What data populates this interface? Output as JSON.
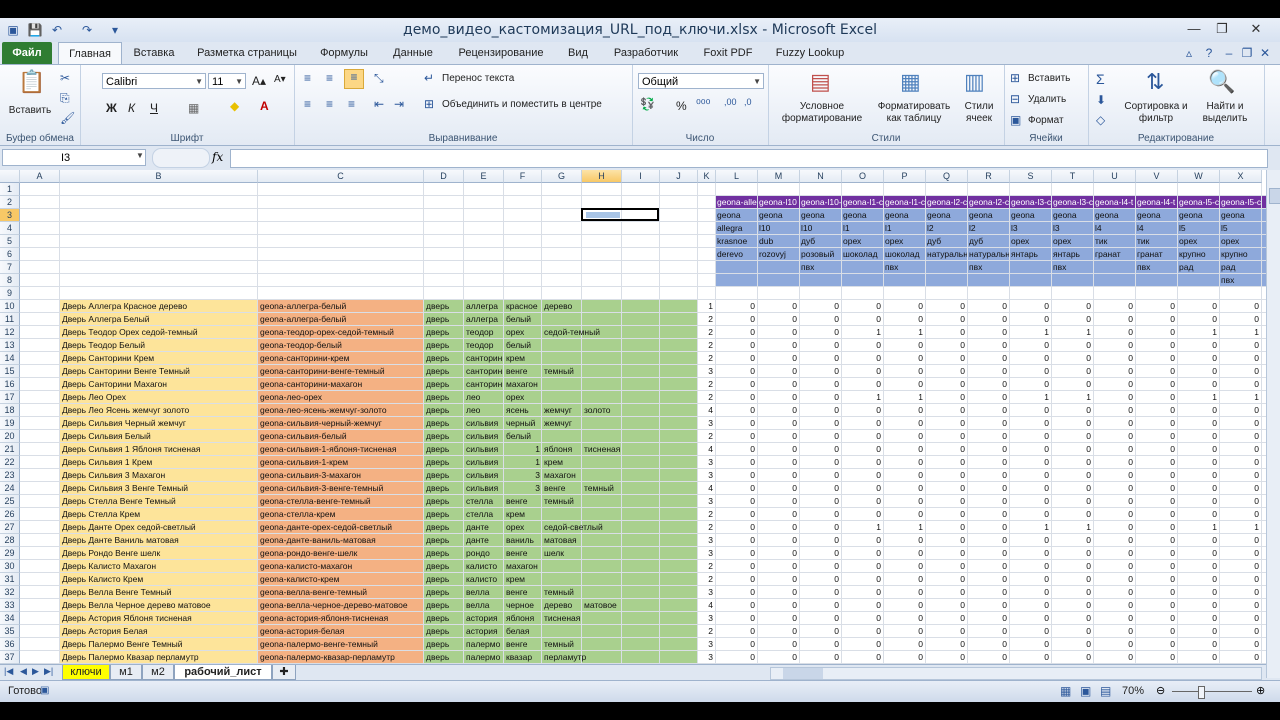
{
  "window": {
    "title": "демо_видео_кастомизация_URL_под_ключи.xlsx - Microsoft Excel"
  },
  "tabs": [
    "Файл",
    "Главная",
    "Вставка",
    "Разметка страницы",
    "Формулы",
    "Данные",
    "Рецензирование",
    "Вид",
    "Разработчик",
    "Foxit PDF",
    "Fuzzy Lookup"
  ],
  "ribbon": {
    "paste": "Вставить",
    "clipboard": "Буфер обмена",
    "font_name": "Calibri",
    "font_size": "11",
    "bold": "Ж",
    "italic": "К",
    "underline": "Ч",
    "font_group": "Шрифт",
    "wrap": "Перенос текста",
    "merge": "Объединить и поместить в центре",
    "align_group": "Выравнивание",
    "number_format": "Общий",
    "percent": "%",
    "number_group": "Число",
    "cond_format": "Условное форматирование",
    "format_table": "Форматировать как таблицу",
    "cell_styles": "Стили ячеек",
    "styles_group": "Стили",
    "insert": "Вставить",
    "delete": "Удалить",
    "format": "Формат",
    "cells_group": "Ячейки",
    "sort": "Сортировка и фильтр",
    "find": "Найти и выделить",
    "edit_group": "Редактирование"
  },
  "formula_bar": {
    "name_box": "I3",
    "fx": "fx",
    "content": ""
  },
  "columns": [
    "A",
    "B",
    "C",
    "D",
    "E",
    "F",
    "G",
    "H",
    "I",
    "J",
    "K",
    "L",
    "M",
    "N",
    "O",
    "P",
    "Q",
    "R",
    "S",
    "T",
    "U",
    "V",
    "W",
    "X"
  ],
  "selected_column": "H",
  "selected_row": "3",
  "header_row2": [
    "geona-alle",
    "geona-l10",
    "geona-l10-",
    "geona-l1-c",
    "geona-l1-c",
    "geona-l2-c",
    "geona-l2-c",
    "geona-l3-c",
    "geona-l3-c",
    "geona-l4-t",
    "geona-l4-t",
    "geona-l5-c",
    "geona-l5-c"
  ],
  "header_block": [
    [
      "geona",
      "allegra",
      "krasnoe",
      "derevo"
    ],
    [
      "geona",
      "l10",
      "dub",
      "rozovyj"
    ],
    [
      "geona",
      "l10",
      "дуб",
      "розовый",
      "пвх"
    ],
    [
      "geona",
      "l1",
      "орех",
      "шоколад"
    ],
    [
      "geona",
      "l1",
      "орех",
      "шоколад",
      "пвх"
    ],
    [
      "geona",
      "l2",
      "дуб",
      "натуральн"
    ],
    [
      "geona",
      "l2",
      "дуб",
      "натуральн",
      "пвх"
    ],
    [
      "geona",
      "l3",
      "орех",
      "янтарь"
    ],
    [
      "geona",
      "l3",
      "орех",
      "янтарь",
      "пвх"
    ],
    [
      "geona",
      "l4",
      "тик",
      "гранат"
    ],
    [
      "geona",
      "l4",
      "тик",
      "гранат",
      "пвх"
    ],
    [
      "geona",
      "l5",
      "орех",
      "крупно",
      "рад"
    ],
    [
      "geona",
      "l5",
      "орех",
      "крупно",
      "рад",
      "пвх"
    ]
  ],
  "rows": [
    {
      "n": "10",
      "b": "Дверь Аллегра Красное дерево",
      "c": "geona-аллегра-белый",
      "w": [
        "дверь",
        "аллегра",
        "красное",
        "дерево"
      ],
      "k": "1",
      "v": [
        "0",
        "0",
        "0",
        "0",
        "0",
        "0",
        "0",
        "0",
        "0",
        "0",
        "0",
        "0",
        "0"
      ]
    },
    {
      "n": "11",
      "b": "Дверь Аллегра Белый",
      "c": "geona-аллегра-белый",
      "w": [
        "дверь",
        "аллегра",
        "белый"
      ],
      "k": "2",
      "v": [
        "0",
        "0",
        "0",
        "0",
        "0",
        "0",
        "0",
        "0",
        "0",
        "0",
        "0",
        "0",
        "0"
      ]
    },
    {
      "n": "12",
      "b": "Дверь Теодор Орех седой-темный",
      "c": "geona-теодор-орех-седой-темный",
      "w": [
        "дверь",
        "теодор",
        "орех",
        "седой-темный"
      ],
      "k": "2",
      "v": [
        "0",
        "0",
        "0",
        "1",
        "1",
        "0",
        "0",
        "1",
        "1",
        "0",
        "0",
        "1",
        "1"
      ]
    },
    {
      "n": "13",
      "b": "Дверь Теодор Белый",
      "c": "geona-теодор-белый",
      "w": [
        "дверь",
        "теодор",
        "белый"
      ],
      "k": "2",
      "v": [
        "0",
        "0",
        "0",
        "0",
        "0",
        "0",
        "0",
        "0",
        "0",
        "0",
        "0",
        "0",
        "0"
      ]
    },
    {
      "n": "14",
      "b": "Дверь Санторини Крем",
      "c": "geona-санторини-крем",
      "w": [
        "дверь",
        "санторини",
        "крем"
      ],
      "k": "2",
      "v": [
        "0",
        "0",
        "0",
        "0",
        "0",
        "0",
        "0",
        "0",
        "0",
        "0",
        "0",
        "0",
        "0"
      ]
    },
    {
      "n": "15",
      "b": "Дверь Санторини Венге Темный",
      "c": "geona-санторини-венге-темный",
      "w": [
        "дверь",
        "санторини",
        "венге",
        "темный"
      ],
      "k": "3",
      "v": [
        "0",
        "0",
        "0",
        "0",
        "0",
        "0",
        "0",
        "0",
        "0",
        "0",
        "0",
        "0",
        "0"
      ]
    },
    {
      "n": "16",
      "b": "Дверь Санторини Махагон",
      "c": "geona-санторини-махагон",
      "w": [
        "дверь",
        "санторини",
        "махагон"
      ],
      "k": "2",
      "v": [
        "0",
        "0",
        "0",
        "0",
        "0",
        "0",
        "0",
        "0",
        "0",
        "0",
        "0",
        "0",
        "0"
      ]
    },
    {
      "n": "17",
      "b": "Дверь Лео Орех",
      "c": "geona-лео-орех",
      "w": [
        "дверь",
        "лео",
        "орех"
      ],
      "k": "2",
      "v": [
        "0",
        "0",
        "0",
        "1",
        "1",
        "0",
        "0",
        "1",
        "1",
        "0",
        "0",
        "1",
        "1"
      ]
    },
    {
      "n": "18",
      "b": "Дверь Лео Ясень жемчуг золото",
      "c": "geona-лео-ясень-жемчуг-золото",
      "w": [
        "дверь",
        "лео",
        "ясень",
        "жемчуг",
        "золото"
      ],
      "k": "4",
      "v": [
        "0",
        "0",
        "0",
        "0",
        "0",
        "0",
        "0",
        "0",
        "0",
        "0",
        "0",
        "0",
        "0"
      ]
    },
    {
      "n": "19",
      "b": "Дверь Сильвия Черный жемчуг",
      "c": "geona-сильвия-черный-жемчуг",
      "w": [
        "дверь",
        "сильвия",
        "черный",
        "жемчуг"
      ],
      "k": "3",
      "v": [
        "0",
        "0",
        "0",
        "0",
        "0",
        "0",
        "0",
        "0",
        "0",
        "0",
        "0",
        "0",
        "0"
      ]
    },
    {
      "n": "20",
      "b": "Дверь Сильвия Белый",
      "c": "geona-сильвия-белый",
      "w": [
        "дверь",
        "сильвия",
        "белый"
      ],
      "k": "2",
      "v": [
        "0",
        "0",
        "0",
        "0",
        "0",
        "0",
        "0",
        "0",
        "0",
        "0",
        "0",
        "0",
        "0"
      ]
    },
    {
      "n": "21",
      "b": "Дверь Сильвия 1 Яблоня тисненая",
      "c": "geona-сильвия-1-яблоня-тисненая",
      "w": [
        "дверь",
        "сильвия",
        "1",
        "яблоня",
        "тисненая"
      ],
      "k": "4",
      "v": [
        "0",
        "0",
        "0",
        "0",
        "0",
        "0",
        "0",
        "0",
        "0",
        "0",
        "0",
        "0",
        "0"
      ]
    },
    {
      "n": "22",
      "b": "Дверь Сильвия 1 Крем",
      "c": "geona-сильвия-1-крем",
      "w": [
        "дверь",
        "сильвия",
        "1",
        "крем"
      ],
      "k": "3",
      "v": [
        "0",
        "0",
        "0",
        "0",
        "0",
        "0",
        "0",
        "0",
        "0",
        "0",
        "0",
        "0",
        "0"
      ]
    },
    {
      "n": "23",
      "b": "Дверь Сильвия 3 Махагон",
      "c": "geona-сильвия-3-махагон",
      "w": [
        "дверь",
        "сильвия",
        "3",
        "махагон"
      ],
      "k": "3",
      "v": [
        "0",
        "0",
        "0",
        "0",
        "0",
        "0",
        "0",
        "0",
        "0",
        "0",
        "0",
        "0",
        "0"
      ]
    },
    {
      "n": "24",
      "b": "Дверь Сильвия 3 Венге Темный",
      "c": "geona-сильвия-3-венге-темный",
      "w": [
        "дверь",
        "сильвия",
        "3",
        "венге",
        "темный"
      ],
      "k": "4",
      "v": [
        "0",
        "0",
        "0",
        "0",
        "0",
        "0",
        "0",
        "0",
        "0",
        "0",
        "0",
        "0",
        "0"
      ]
    },
    {
      "n": "25",
      "b": "Дверь Стелла Венге Темный",
      "c": "geona-стелла-венге-темный",
      "w": [
        "дверь",
        "стелла",
        "венге",
        "темный"
      ],
      "k": "3",
      "v": [
        "0",
        "0",
        "0",
        "0",
        "0",
        "0",
        "0",
        "0",
        "0",
        "0",
        "0",
        "0",
        "0"
      ]
    },
    {
      "n": "26",
      "b": "Дверь Стелла Крем",
      "c": "geona-стелла-крем",
      "w": [
        "дверь",
        "стелла",
        "крем"
      ],
      "k": "2",
      "v": [
        "0",
        "0",
        "0",
        "0",
        "0",
        "0",
        "0",
        "0",
        "0",
        "0",
        "0",
        "0",
        "0"
      ]
    },
    {
      "n": "27",
      "b": "Дверь Данте Орех седой-светлый",
      "c": "geona-данте-орех-седой-светлый",
      "w": [
        "дверь",
        "данте",
        "орех",
        "седой-светлый"
      ],
      "k": "2",
      "v": [
        "0",
        "0",
        "0",
        "1",
        "1",
        "0",
        "0",
        "1",
        "1",
        "0",
        "0",
        "1",
        "1"
      ]
    },
    {
      "n": "28",
      "b": "Дверь Данте Ваниль матовая",
      "c": "geona-данте-ваниль-матовая",
      "w": [
        "дверь",
        "данте",
        "ваниль",
        "матовая"
      ],
      "k": "3",
      "v": [
        "0",
        "0",
        "0",
        "0",
        "0",
        "0",
        "0",
        "0",
        "0",
        "0",
        "0",
        "0",
        "0"
      ]
    },
    {
      "n": "29",
      "b": "Дверь Рондо Венге шелк",
      "c": "geona-рондо-венге-шелк",
      "w": [
        "дверь",
        "рондо",
        "венге",
        "шелк"
      ],
      "k": "3",
      "v": [
        "0",
        "0",
        "0",
        "0",
        "0",
        "0",
        "0",
        "0",
        "0",
        "0",
        "0",
        "0",
        "0"
      ]
    },
    {
      "n": "30",
      "b": "Дверь Калисто Махагон",
      "c": "geona-калисто-махагон",
      "w": [
        "дверь",
        "калисто",
        "махагон"
      ],
      "k": "2",
      "v": [
        "0",
        "0",
        "0",
        "0",
        "0",
        "0",
        "0",
        "0",
        "0",
        "0",
        "0",
        "0",
        "0"
      ]
    },
    {
      "n": "31",
      "b": "Дверь Калисто Крем",
      "c": "geona-калисто-крем",
      "w": [
        "дверь",
        "калисто",
        "крем"
      ],
      "k": "2",
      "v": [
        "0",
        "0",
        "0",
        "0",
        "0",
        "0",
        "0",
        "0",
        "0",
        "0",
        "0",
        "0",
        "0"
      ]
    },
    {
      "n": "32",
      "b": "Дверь Велла Венге Темный",
      "c": "geona-велла-венге-темный",
      "w": [
        "дверь",
        "велла",
        "венге",
        "темный"
      ],
      "k": "3",
      "v": [
        "0",
        "0",
        "0",
        "0",
        "0",
        "0",
        "0",
        "0",
        "0",
        "0",
        "0",
        "0",
        "0"
      ]
    },
    {
      "n": "33",
      "b": "Дверь Велла Черное дерево матовое",
      "c": "geona-велла-черное-дерево-матовое",
      "w": [
        "дверь",
        "велла",
        "черное",
        "дерево",
        "матовое"
      ],
      "k": "4",
      "v": [
        "0",
        "0",
        "0",
        "0",
        "0",
        "0",
        "0",
        "0",
        "0",
        "0",
        "0",
        "0",
        "0"
      ]
    },
    {
      "n": "34",
      "b": "Дверь Астория Яблоня тисненая",
      "c": "geona-астория-яблоня-тисненая",
      "w": [
        "дверь",
        "астория",
        "яблоня",
        "тисненая"
      ],
      "k": "3",
      "v": [
        "0",
        "0",
        "0",
        "0",
        "0",
        "0",
        "0",
        "0",
        "0",
        "0",
        "0",
        "0",
        "0"
      ]
    },
    {
      "n": "35",
      "b": "Дверь Астория Белая",
      "c": "geona-астория-белая",
      "w": [
        "дверь",
        "астория",
        "белая"
      ],
      "k": "2",
      "v": [
        "0",
        "0",
        "0",
        "0",
        "0",
        "0",
        "0",
        "0",
        "0",
        "0",
        "0",
        "0",
        "0"
      ]
    },
    {
      "n": "36",
      "b": "Дверь Палермо Венге Темный",
      "c": "geona-палермо-венге-темный",
      "w": [
        "дверь",
        "палермо",
        "венге",
        "темный"
      ],
      "k": "3",
      "v": [
        "0",
        "0",
        "0",
        "0",
        "0",
        "0",
        "0",
        "0",
        "0",
        "0",
        "0",
        "0",
        "0"
      ]
    },
    {
      "n": "37",
      "b": "Дверь Палермо Квазар перламутр",
      "c": "geona-палермо-квазар-перламутр",
      "w": [
        "дверь",
        "палермо",
        "квазар",
        "перламутр"
      ],
      "k": "3",
      "v": [
        "0",
        "0",
        "0",
        "0",
        "0",
        "0",
        "0",
        "0",
        "0",
        "0",
        "0",
        "0",
        "0"
      ]
    }
  ],
  "sheets": [
    "ключи",
    "м1",
    "м2",
    "рабочий_лист"
  ],
  "active_sheet": "рабочий_лист",
  "status": {
    "ready": "Готово",
    "zoom": "70%"
  },
  "colors": {
    "yellow": "#fde49a",
    "orange": "#f4b183",
    "green": "#a9d08e",
    "blue": "#8ea9db",
    "purple": "#7030a0"
  }
}
